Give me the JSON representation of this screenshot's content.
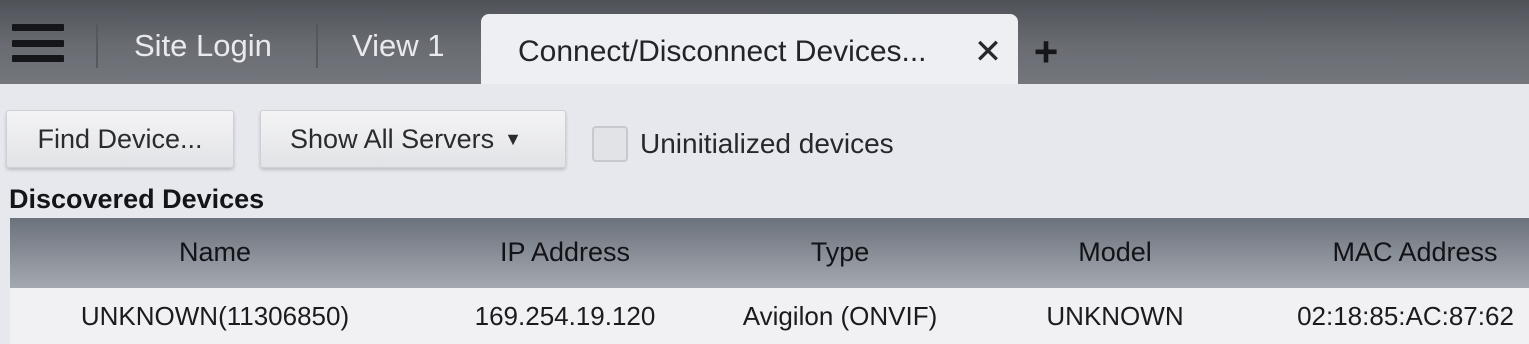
{
  "tabs": {
    "items": [
      "Site Login",
      "View 1"
    ],
    "active": "Connect/Disconnect Devices...",
    "close_icon": "close-icon",
    "add_icon": "plus-icon"
  },
  "toolbar": {
    "find_label": "Find Device...",
    "servers_label": "Show All Servers",
    "servers_caret": "▼",
    "uninitialized_label": "Uninitialized devices",
    "uninitialized_checked": false
  },
  "section_title": "Discovered Devices",
  "table": {
    "columns": [
      "Name",
      "IP Address",
      "Type",
      "Model",
      "MAC Address"
    ],
    "rows": [
      [
        "UNKNOWN(11306850)",
        "169.254.19.120",
        "Avigilon (ONVIF)",
        "UNKNOWN",
        "02:18:85:AC:87:62"
      ]
    ]
  }
}
